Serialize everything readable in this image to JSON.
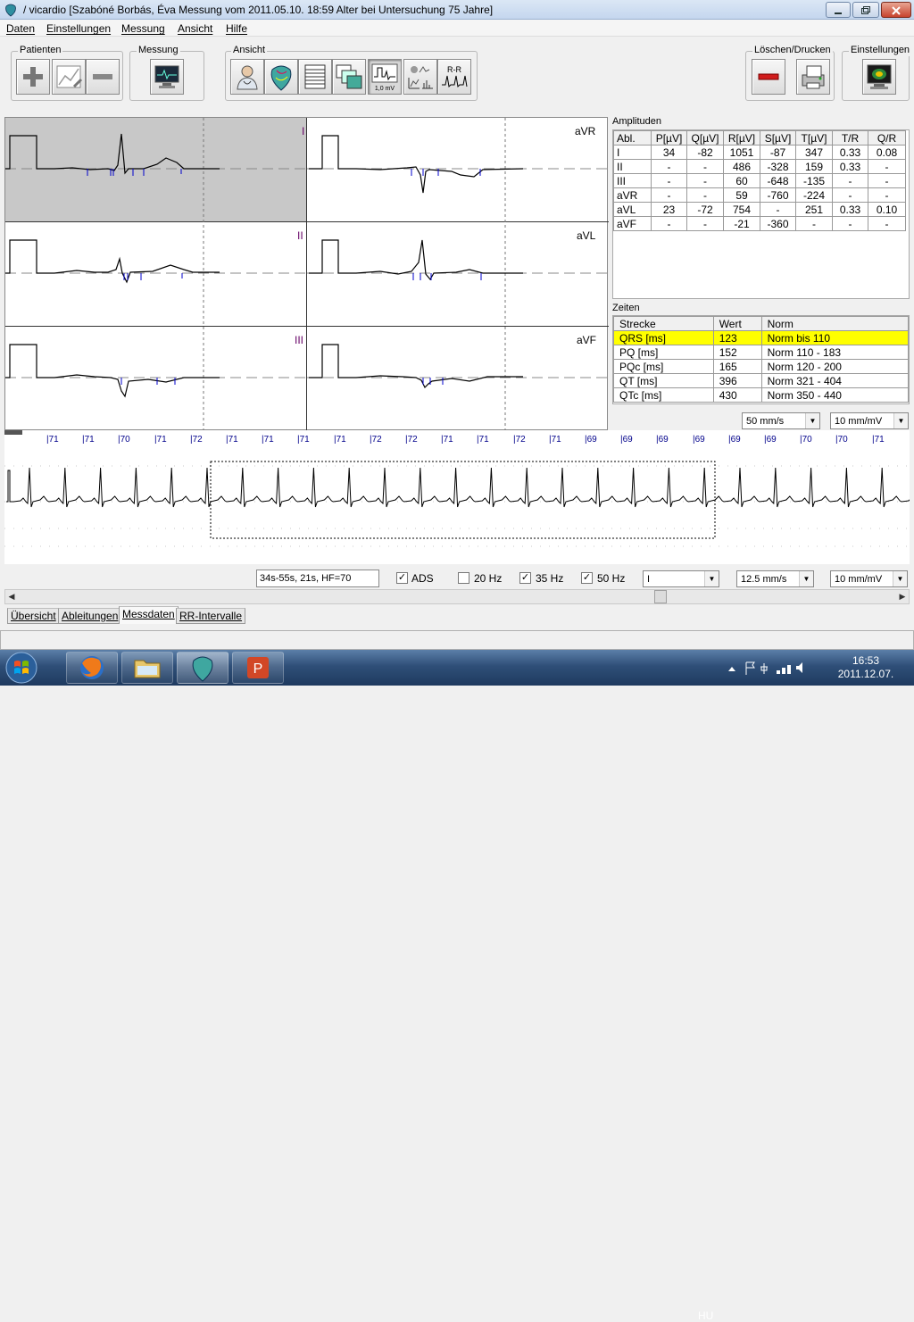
{
  "window": {
    "title": "/ vicardio [Szabóné Borbás, Éva Messung vom 2011.05.10. 18:59 Alter bei Untersuchung 75 Jahre]",
    "minimize_icon": "minimize-icon",
    "maximize_icon": "maximize-icon",
    "close_icon": "close-icon"
  },
  "menu": [
    "Daten",
    "Einstellungen",
    "Messung",
    "Ansicht",
    "Hilfe"
  ],
  "toolbar": {
    "groups": {
      "patienten": "Patienten",
      "messung": "Messung",
      "ansicht": "Ansicht",
      "loeschen": "Löschen/Drucken",
      "einstellungen": "Einstellungen"
    },
    "mv_label": "1,0 mV",
    "rr_label": "R-R"
  },
  "leads": {
    "left": [
      "I",
      "II",
      "III"
    ],
    "right": [
      "aVR",
      "aVL",
      "aVF"
    ]
  },
  "amplitudes": {
    "label": "Amplituden",
    "headers": [
      "Abl.",
      "P[µV]",
      "Q[µV]",
      "R[µV]",
      "S[µV]",
      "T[µV]",
      "T/R",
      "Q/R"
    ],
    "rows": [
      [
        "I",
        "34",
        "-82",
        "1051",
        "-87",
        "347",
        "0.33",
        "0.08"
      ],
      [
        "II",
        "-",
        "-",
        "486",
        "-328",
        "159",
        "0.33",
        "-"
      ],
      [
        "III",
        "-",
        "-",
        "60",
        "-648",
        "-135",
        "-",
        "-"
      ],
      [
        "aVR",
        "-",
        "-",
        "59",
        "-760",
        "-224",
        "-",
        "-"
      ],
      [
        "aVL",
        "23",
        "-72",
        "754",
        "-",
        "251",
        "0.33",
        "0.10"
      ],
      [
        "aVF",
        "-",
        "-",
        "-21",
        "-360",
        "-",
        "-",
        "-"
      ]
    ]
  },
  "zeiten": {
    "label": "Zeiten",
    "headers": [
      "Strecke",
      "Wert",
      "Norm"
    ],
    "rows": [
      [
        "QRS [ms]",
        "123",
        "Norm bis 110"
      ],
      [
        "PQ [ms]",
        "152",
        "Norm 110 - 183"
      ],
      [
        "PQc [ms]",
        "165",
        "Norm 120 - 200"
      ],
      [
        "QT [ms]",
        "396",
        "Norm 321 - 404"
      ],
      [
        "QTc [ms]",
        "430",
        "Norm 350 - 440"
      ]
    ],
    "highlight_color": "#ffff00"
  },
  "ecg_settings": {
    "speed": "50 mm/s",
    "gain": "10 mm/mV"
  },
  "rr_values": [
    "71",
    "71",
    "70",
    "71",
    "72",
    "71",
    "71",
    "71",
    "71",
    "72",
    "72",
    "71",
    "71",
    "72",
    "71",
    "69",
    "69",
    "69",
    "69",
    "69",
    "69",
    "70",
    "70",
    "71"
  ],
  "bottom": {
    "info": "34s-55s, 21s, HF=70",
    "ads_label": "ADS",
    "ads_checked": true,
    "hz20_label": "20 Hz",
    "hz20_checked": false,
    "hz35_label": "35 Hz",
    "hz35_checked": true,
    "hz50_label": "50 Hz",
    "hz50_checked": true,
    "lead_select": "I",
    "speed": "12.5 mm/s",
    "gain": "10 mm/mV"
  },
  "tabs": [
    "Übersicht",
    "Ableitungen",
    "Messdaten",
    "RR-Intervalle"
  ],
  "active_tab": "Messdaten",
  "taskbar": {
    "lang": "HU",
    "time": "16:53",
    "date": "2011.12.07."
  },
  "colors": {
    "trace": "#000000",
    "marker": "#0000cc",
    "lead_label_left": "#660066",
    "selected_cell": "#c8c8c8"
  }
}
